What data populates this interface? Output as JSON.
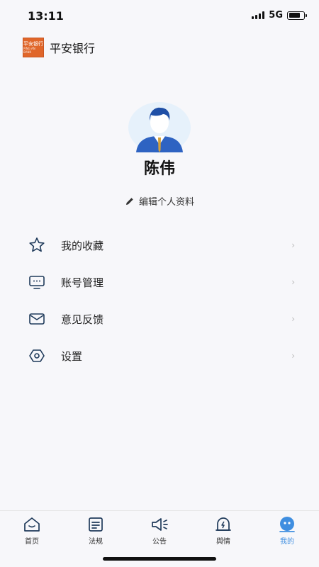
{
  "status": {
    "time": "13:11",
    "network": "5G",
    "battery_level": 0.75
  },
  "header": {
    "logo_line1": "平安银行",
    "logo_line2": "PING AN BANK",
    "app_title": "平安银行"
  },
  "profile": {
    "name": "陈伟",
    "edit_label": "编辑个人资料"
  },
  "menu": [
    {
      "label": "我的收藏",
      "icon": "star-icon"
    },
    {
      "label": "账号管理",
      "icon": "account-icon"
    },
    {
      "label": "意见反馈",
      "icon": "mail-icon"
    },
    {
      "label": "设置",
      "icon": "settings-icon"
    }
  ],
  "tabs": [
    {
      "label": "首页",
      "icon": "home-icon"
    },
    {
      "label": "法规",
      "icon": "document-icon"
    },
    {
      "label": "公告",
      "icon": "megaphone-icon"
    },
    {
      "label": "舆情",
      "icon": "bell-lightning-icon"
    },
    {
      "label": "我的",
      "icon": "profile-face-icon",
      "active": true
    }
  ],
  "colors": {
    "accent": "#3f8ee0",
    "logo": "#e0662a",
    "background": "#f7f7fa"
  }
}
